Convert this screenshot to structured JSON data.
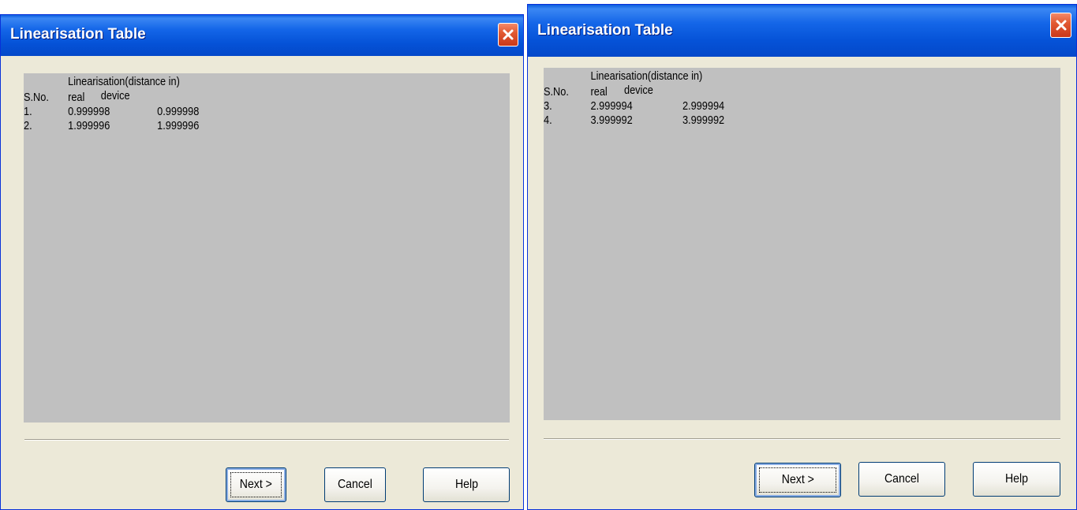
{
  "dialogs": [
    {
      "title": "Linearisation Table",
      "header": "Linearisation(distance in)",
      "columns": [
        "S.No.",
        "real",
        "device"
      ],
      "rows": [
        {
          "sno": "1.",
          "real": "0.999998",
          "device": "0.999998"
        },
        {
          "sno": "2.",
          "real": "1.999996",
          "device": "1.999996"
        }
      ],
      "buttons": {
        "next": "Next >",
        "cancel": "Cancel",
        "help": "Help"
      }
    },
    {
      "title": "Linearisation Table",
      "header": "Linearisation(distance in)",
      "columns": [
        "S.No.",
        "real",
        "device"
      ],
      "rows": [
        {
          "sno": "3.",
          "real": "2.999994",
          "device": "2.999994"
        },
        {
          "sno": "4.",
          "real": "3.999992",
          "device": "3.999992"
        }
      ],
      "buttons": {
        "next": "Next >",
        "cancel": "Cancel",
        "help": "Help"
      }
    }
  ],
  "icons": {
    "close": "close-icon"
  },
  "colors": {
    "titlebar": "#0552d7",
    "dialog_bg": "#ece9d8",
    "panel_bg": "#c0c0c0",
    "close_btn": "#e25a33"
  }
}
